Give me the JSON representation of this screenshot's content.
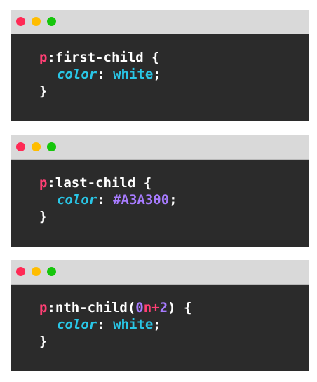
{
  "colors": {
    "window_bg": "#2b2b2b",
    "titlebar_bg": "#d9d9d9",
    "dot_close": "#ff2a55",
    "dot_minimize": "#ffbd00",
    "dot_maximize": "#16c60c",
    "selector": "#ff3f74",
    "punctuation": "#ffffff",
    "property": "#29c6e6",
    "value_keyword": "#29c6e6",
    "value_hex": "#a77bff",
    "number": "#a77bff"
  },
  "icons": {
    "close": "close-dot-icon",
    "minimize": "minimize-dot-icon",
    "maximize": "maximize-dot-icon"
  },
  "windows": [
    {
      "selector_tag": "p",
      "pseudo": ":first-child",
      "open_brace": " {",
      "property": "color",
      "colon": ": ",
      "value": "white",
      "semicolon": ";",
      "close_brace": "}"
    },
    {
      "selector_tag": "p",
      "pseudo": ":last-child",
      "open_brace": " {",
      "property": "color",
      "colon": ": ",
      "value": "#A3A300",
      "semicolon": ";",
      "close_brace": "}"
    },
    {
      "selector_tag": "p",
      "pseudo": ":nth-child(",
      "arg_coef": "0",
      "arg_n": "n",
      "arg_plus": "+",
      "arg_const": "2",
      "pseudo_close": ")",
      "open_brace": " {",
      "property": "color",
      "colon": ": ",
      "value": "white",
      "semicolon": ";",
      "close_brace": "}"
    }
  ]
}
